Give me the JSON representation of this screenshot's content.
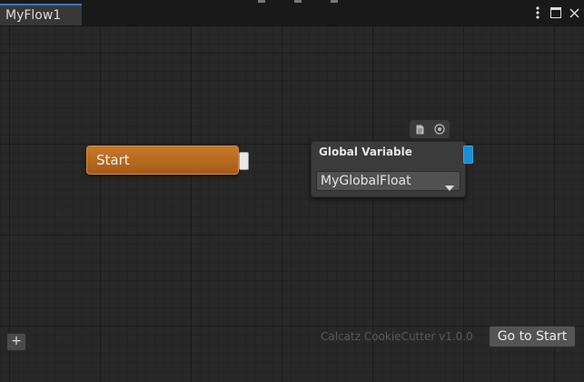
{
  "window": {
    "tab_title": "MyFlow1",
    "controls": [
      "more-options-icon",
      "maximize-icon",
      "close-icon"
    ]
  },
  "nodes": {
    "start": {
      "label": "Start",
      "color": "#b8681f"
    },
    "global_variable": {
      "title": "Global Variable",
      "selected_value": "MyGlobalFloat",
      "toolbar_icons": [
        "document-icon",
        "target-icon"
      ],
      "port_color": "#1f8bd1"
    }
  },
  "footer": {
    "add_label": "+",
    "watermark": "Calcatz CookieCutter v1.0.0",
    "goto_label": "Go to Start"
  }
}
